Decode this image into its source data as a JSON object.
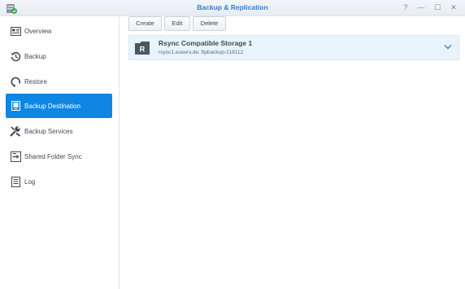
{
  "window": {
    "title": "Backup & Replication",
    "controls": [
      "?",
      "—",
      "☐",
      "✕"
    ]
  },
  "sidebar": {
    "items": [
      {
        "label": "Overview",
        "icon": "overview-icon",
        "active": false
      },
      {
        "label": "Backup",
        "icon": "backup-icon",
        "active": false
      },
      {
        "label": "Restore",
        "icon": "restore-icon",
        "active": false
      },
      {
        "label": "Backup Destination",
        "icon": "backup-destination-icon",
        "active": true
      },
      {
        "label": "Backup Services",
        "icon": "backup-services-icon",
        "active": false
      },
      {
        "label": "Shared Folder Sync",
        "icon": "shared-folder-sync-icon",
        "active": false
      },
      {
        "label": "Log",
        "icon": "log-icon",
        "active": false
      }
    ]
  },
  "toolbar": {
    "create_label": "Create",
    "edit_label": "Edit",
    "delete_label": "Delete"
  },
  "destinations": [
    {
      "name": "Rsync Compatible Storage 1",
      "detail": "rsync1.euserv.de: ftpbackup-218112",
      "icon_letter": "R"
    }
  ],
  "colors": {
    "accent": "#0f86e2",
    "title": "#2e7fd1",
    "row_highlight": "#e9f3fb"
  }
}
